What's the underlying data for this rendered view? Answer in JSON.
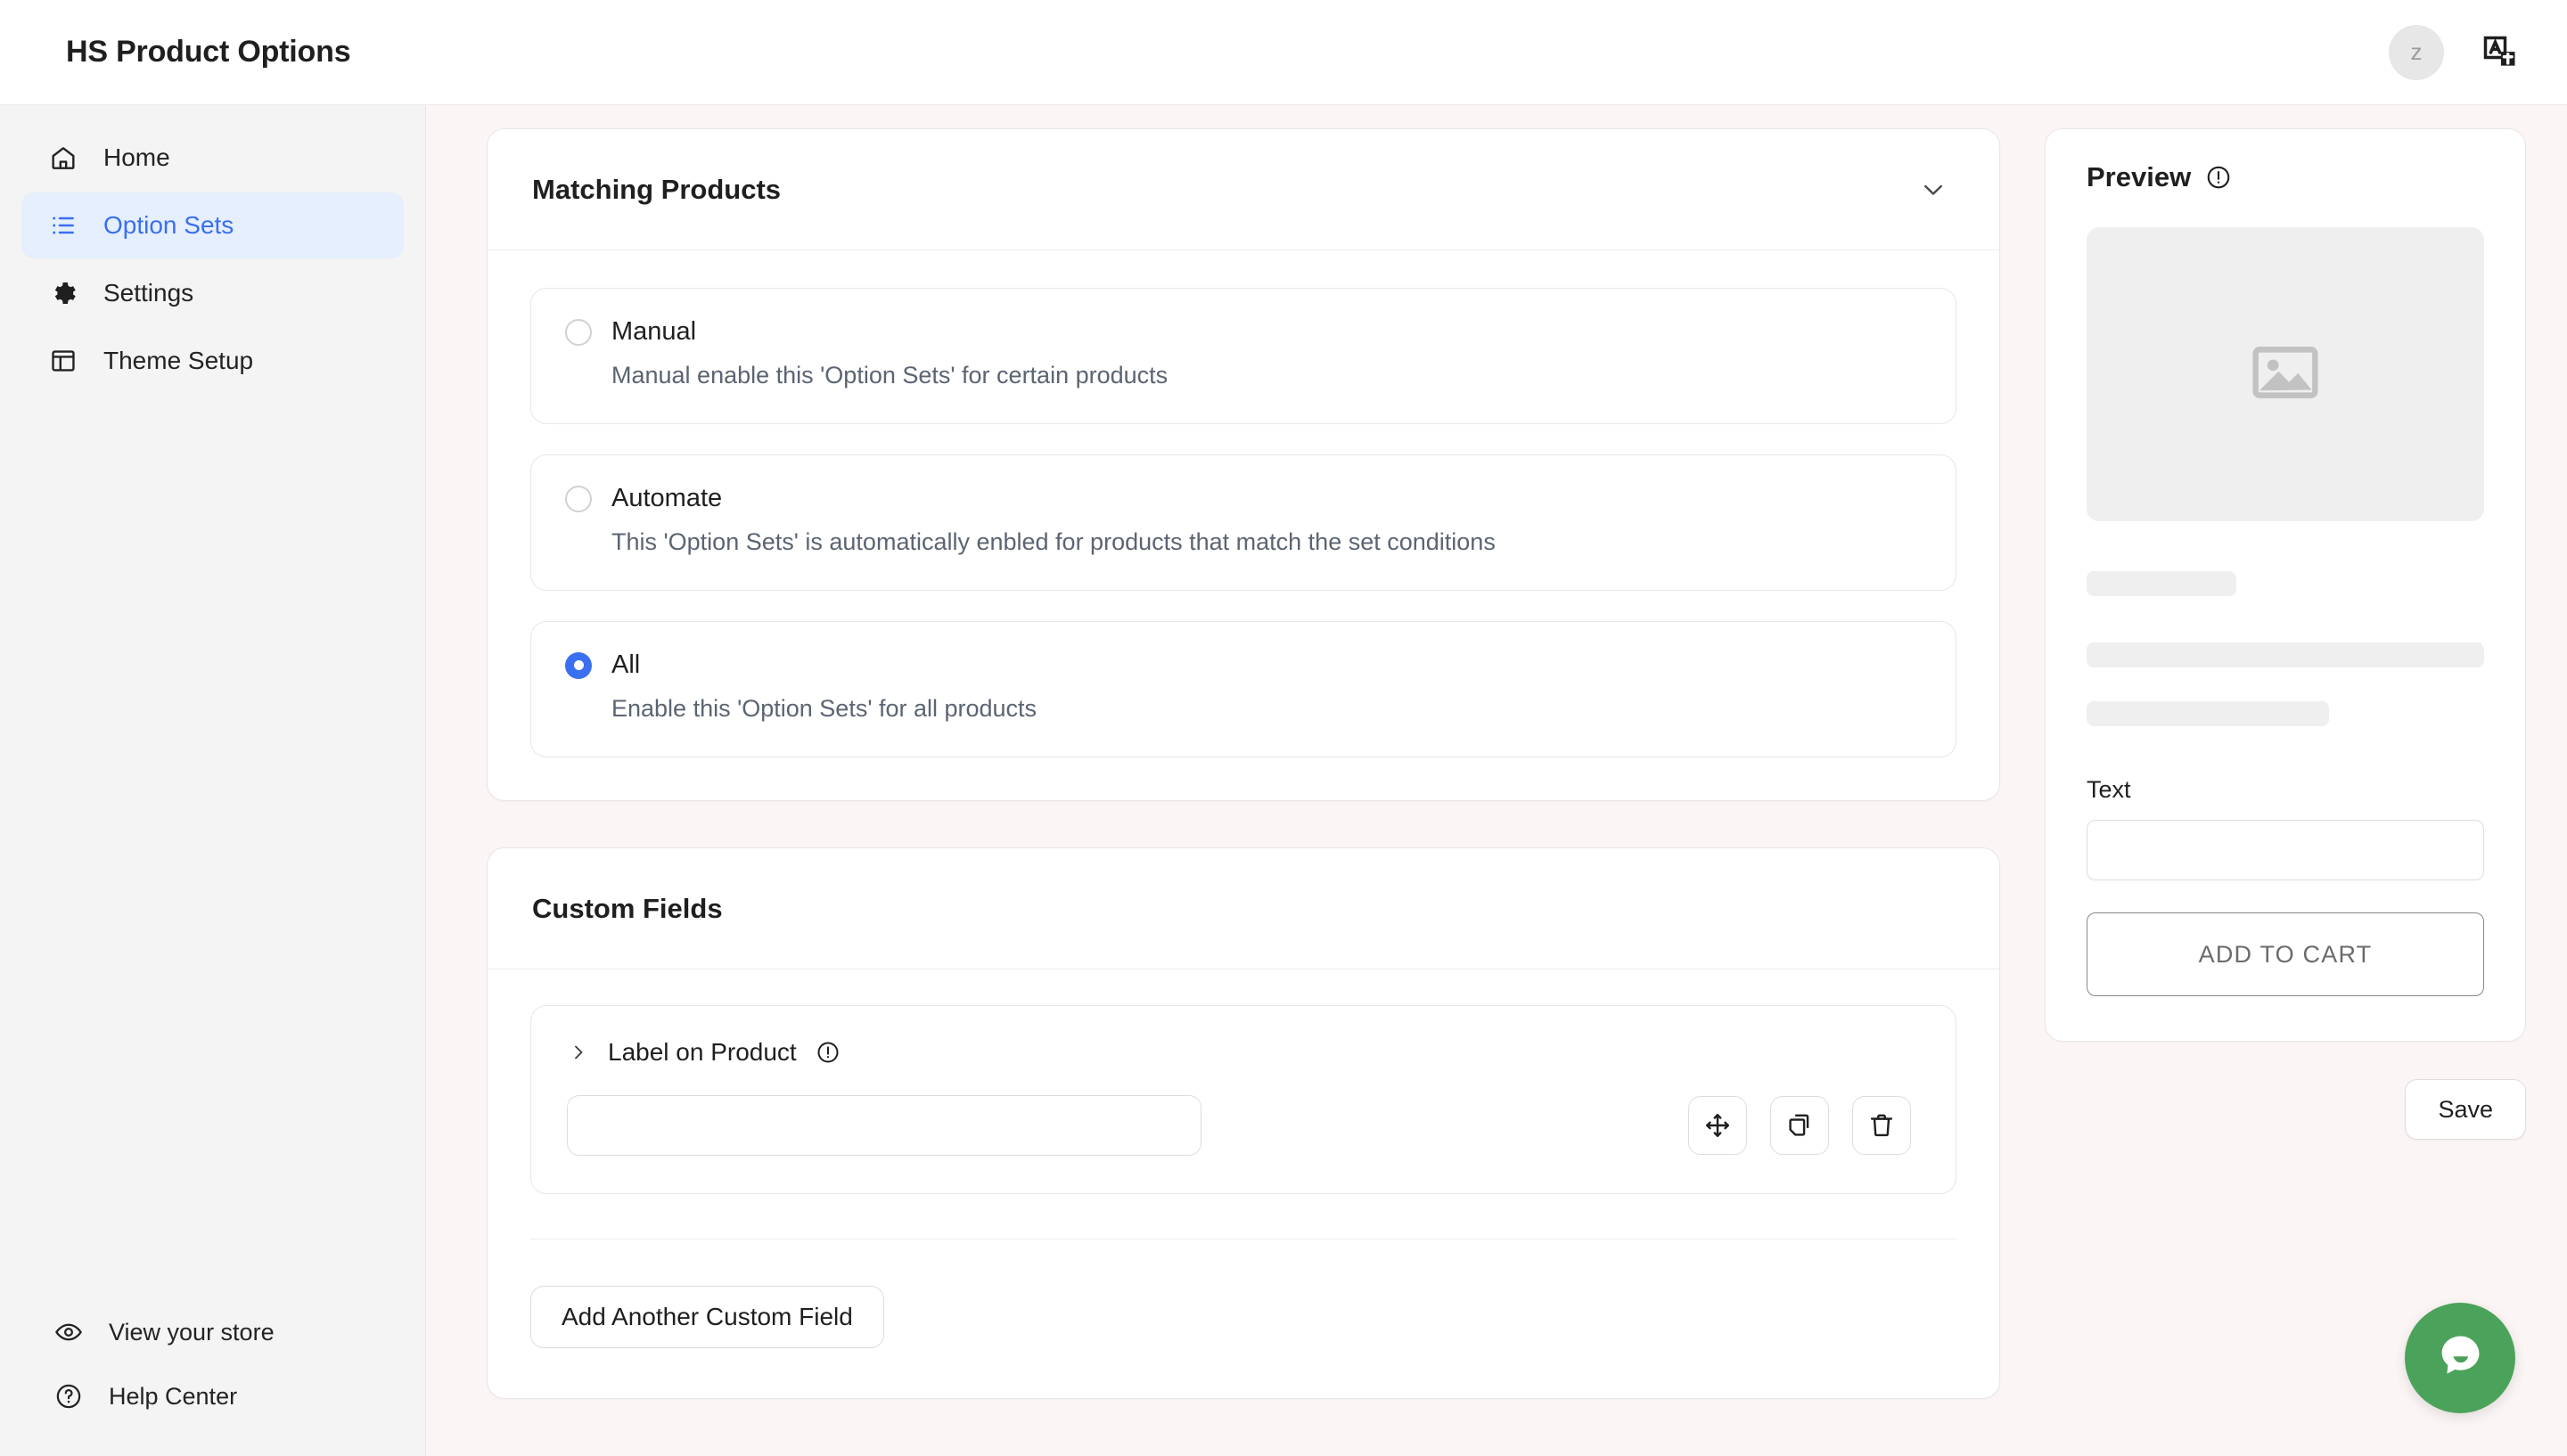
{
  "header": {
    "title": "HS Product Options",
    "avatar_initial": "z",
    "language_icon": "translate-icon"
  },
  "sidebar": {
    "items": [
      {
        "label": "Home",
        "icon": "home-icon",
        "active": false
      },
      {
        "label": "Option Sets",
        "icon": "list-icon",
        "active": true
      },
      {
        "label": "Settings",
        "icon": "gear-icon",
        "active": false
      },
      {
        "label": "Theme Setup",
        "icon": "layout-icon",
        "active": false
      }
    ],
    "bottom_items": [
      {
        "label": "View your store",
        "icon": "eye-icon"
      },
      {
        "label": "Help Center",
        "icon": "question-circle-icon"
      }
    ]
  },
  "matching_products": {
    "title": "Matching Products",
    "collapse_icon": "chevron-down-icon",
    "options": [
      {
        "label": "Manual",
        "description": "Manual enable this 'Option Sets' for certain products",
        "selected": false
      },
      {
        "label": "Automate",
        "description": "This 'Option Sets' is automatically enbled for products that match the set conditions",
        "selected": false
      },
      {
        "label": "All",
        "description": "Enable this 'Option Sets' for all products",
        "selected": true
      }
    ]
  },
  "custom_fields": {
    "title": "Custom Fields",
    "field": {
      "label": "Label on Product",
      "expand_icon": "chevron-right-icon",
      "info_icon": "info-circle-icon",
      "input_value": "",
      "input_placeholder": "",
      "actions": [
        {
          "name": "move-icon",
          "glyph": "move"
        },
        {
          "name": "duplicate-icon",
          "glyph": "copy"
        },
        {
          "name": "delete-icon",
          "glyph": "trash"
        }
      ]
    },
    "add_button_label": "Add Another Custom Field"
  },
  "preview": {
    "title": "Preview",
    "info_icon": "info-circle-icon",
    "image_placeholder_icon": "image-icon",
    "text_field_label": "Text",
    "text_field_value": "",
    "add_to_cart_label": "ADD TO CART"
  },
  "footer": {
    "save_label": "Save"
  },
  "chat": {
    "icon": "chat-bubble-icon",
    "color": "#4ba35b"
  },
  "colors": {
    "accent": "#3a6ff0",
    "active_nav_bg": "#e5effd",
    "page_bg": "#fbf6f5",
    "sidebar_bg": "#f5f4f4"
  }
}
